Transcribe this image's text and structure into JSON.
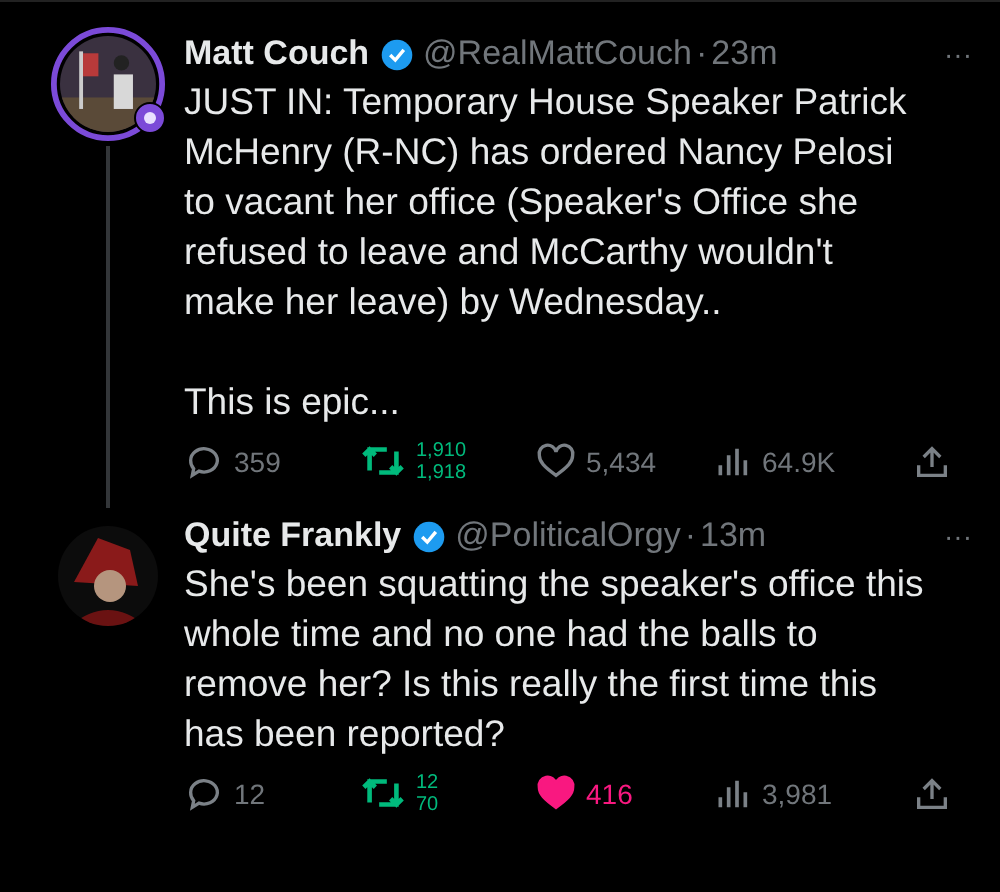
{
  "tweets": [
    {
      "name": "Matt Couch",
      "verified": true,
      "handle": "@RealMattCouch",
      "dot": "·",
      "time": "23m",
      "more": "···",
      "ring": true,
      "thread_line": true,
      "text": "JUST IN: Temporary House Speaker Patrick McHenry (R-NC) has ordered Nancy Pelosi to vacant her office (Speaker's Office she refused to leave and McCarthy wouldn't make her leave) by Wednesday..\n\nThis is epic...",
      "replies": "359",
      "retweets_out": "1,910",
      "retweets_in": "1,918",
      "retweeted": true,
      "likes": "5,434",
      "liked": false,
      "views": "64.9K"
    },
    {
      "name": "Quite Frankly",
      "verified": true,
      "handle": "@PoliticalOrgy",
      "dot": "·",
      "time": "13m",
      "more": "···",
      "ring": false,
      "thread_line": false,
      "text": "She's been squatting the speaker's office this whole time and no one had the balls to remove her?  Is this really the first time this has been reported?",
      "replies": "12",
      "retweets_out": "12",
      "retweets_in": "70",
      "retweeted": true,
      "likes": "416",
      "liked": true,
      "views": "3,981"
    }
  ]
}
